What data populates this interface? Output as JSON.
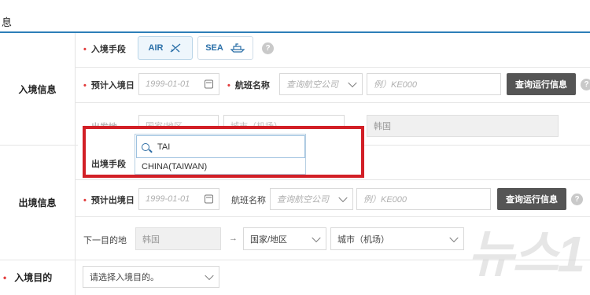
{
  "header": {
    "title": "息"
  },
  "sections": {
    "entry": "入境信息",
    "exit": "出境信息",
    "purpose": "入境目的"
  },
  "entry": {
    "mode_label": "入境手段",
    "modes": [
      {
        "label": "AIR",
        "icon": "airplane-icon",
        "selected": true
      },
      {
        "label": "SEA",
        "icon": "ship-icon",
        "selected": false
      }
    ],
    "date_label": "预计入境日",
    "date_placeholder": "1999-01-01",
    "flight_label": "航班名称",
    "airline_placeholder": "查询航空公司",
    "flight_placeholder": "例）KE000",
    "query_button": "查询运行信息",
    "departure_label": "出发地",
    "country_value": "国家/地区",
    "city_value": "城市（机场）",
    "destination_value": "韩国"
  },
  "exit_mode": {
    "label": "出境手段",
    "search_value": "TAI",
    "option": "CHINA(TAIWAN)"
  },
  "exit": {
    "date_label": "预计出境日",
    "date_placeholder": "1999-01-01",
    "flight_label": "航班名称",
    "airline_placeholder": "查询航空公司",
    "flight_placeholder": "例）KE000",
    "query_button": "查询运行信息",
    "next_dest_label": "下一目的地",
    "next_dest_value": "韩国",
    "arrow": "→",
    "country_value": "国家/地区",
    "city_value": "城市（机场）"
  },
  "purpose": {
    "placeholder": "请选择入境目的。"
  },
  "help_glyph": "?",
  "watermark": "뉴스1",
  "colors": {
    "accent": "#2d7fb8",
    "required": "#e23b3b",
    "highlight": "#d21f26",
    "button": "#555555"
  }
}
